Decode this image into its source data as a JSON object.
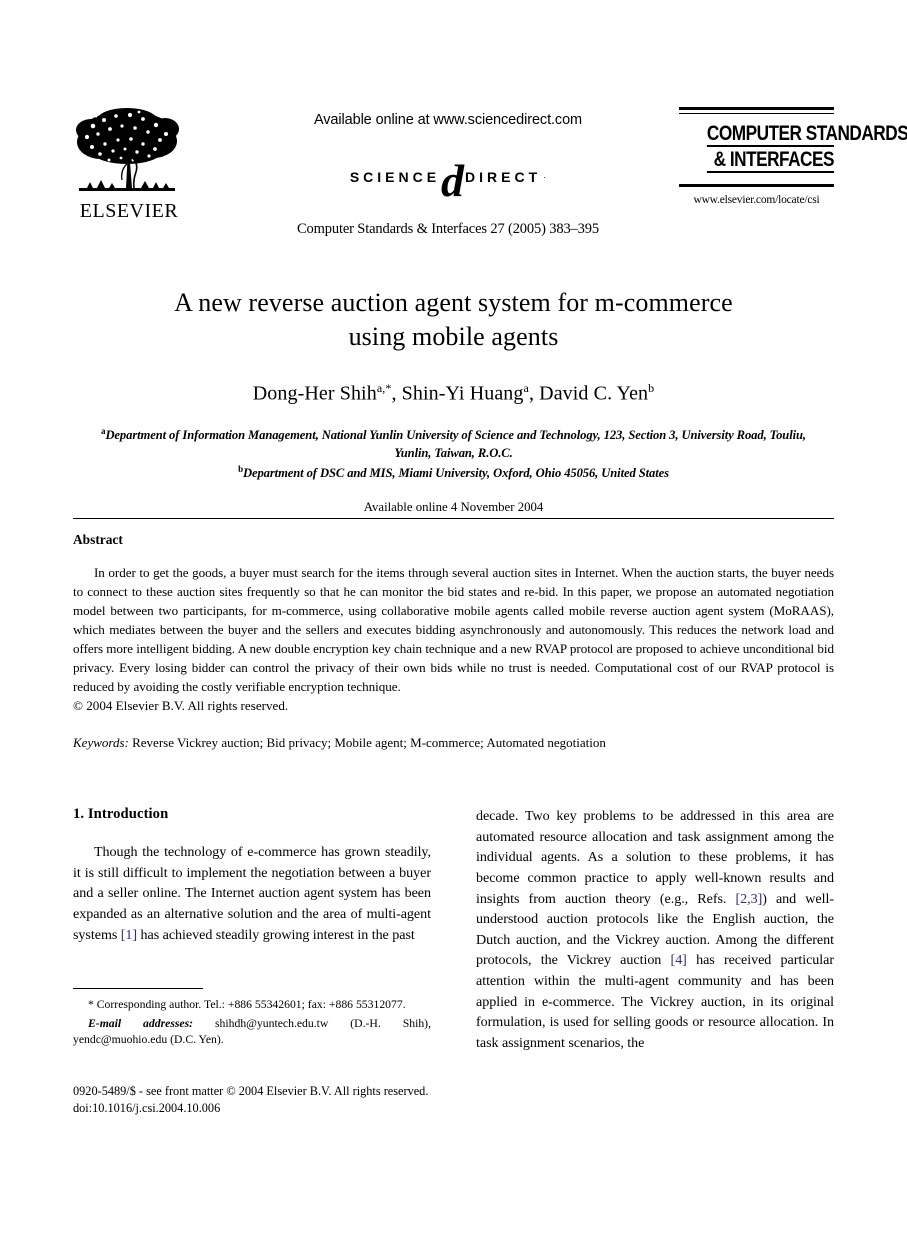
{
  "masthead": {
    "publisher_name": "ELSEVIER",
    "publisher_logo_icon": "elsevier-tree-logo",
    "available_online": "Available online at www.sciencedirect.com",
    "sciencedirect_word_left": "SCIENCE",
    "sciencedirect_glyph": "d",
    "sciencedirect_word_right": "DIRECT",
    "sciencedirect_registered": "·",
    "journal_citation": "Computer Standards & Interfaces 27 (2005) 383–395",
    "journal_logo_line1": "COMPUTER STANDARDS",
    "journal_logo_line2": "& INTERFACES",
    "journal_url": "www.elsevier.com/locate/csi"
  },
  "title": {
    "line1": "A new reverse auction agent system for m-commerce",
    "line2": "using mobile agents"
  },
  "authors": {
    "text": "Dong-Her Shih",
    "sup1": "a,*",
    "text2": ", Shin-Yi Huang",
    "sup2": "a",
    "text3": ", David C. Yen",
    "sup3": "b"
  },
  "affiliations": {
    "a_marker": "a",
    "a_text": "Department of Information Management, National Yunlin University of Science and Technology, 123, Section 3, University Road, Touliu, Yunlin, Taiwan, R.O.C.",
    "b_marker": "b",
    "b_text": "Department of DSC and MIS, Miami University, Oxford, Ohio 45056, United States",
    "available_date": "Available online 4 November 2004"
  },
  "abstract": {
    "heading": "Abstract",
    "body": "In order to get the goods, a buyer must search for the items through several auction sites in Internet. When the auction starts, the buyer needs to connect to these auction sites frequently so that he can monitor the bid states and re-bid. In this paper, we propose an automated negotiation model between two participants, for m-commerce, using collaborative mobile agents called mobile reverse auction agent system (MoRAAS), which mediates between the buyer and the sellers and executes bidding asynchronously and autonomously. This reduces the network load and offers more intelligent bidding. A new double encryption key chain technique and a new RVAP protocol are proposed to achieve unconditional bid privacy. Every losing bidder can control the privacy of their own bids while no trust is needed. Computational cost of our RVAP protocol is reduced by avoiding the costly verifiable encryption technique.",
    "copyright": "© 2004 Elsevier B.V. All rights reserved.",
    "keywords_label": "Keywords:",
    "keywords_value": "Reverse Vickrey auction; Bid privacy; Mobile agent; M-commerce; Automated negotiation"
  },
  "introduction": {
    "heading": "1. Introduction",
    "left_part1": "Though the technology of e-commerce has grown steadily, it is still difficult to implement the negotiation between a buyer and a seller online. The Internet auction agent system has been expanded as an alternative solution and the area of multi-agent systems ",
    "left_ref1": "[1]",
    "left_part2": " has achieved steadily growing interest in the past",
    "right_part1": "decade. Two key problems to be addressed in this area are automated resource allocation and task assignment among the individual agents. As a solution to these problems, it has become common practice to apply well-known results and insights from auction theory (e.g., Refs. ",
    "right_ref1": "[2,3]",
    "right_part2": ") and well-understood auction protocols like the English auction, the Dutch auction, and the Vickrey auction. Among the different protocols, the Vickrey auction ",
    "right_ref2": "[4]",
    "right_part3": " has received particular attention within the multi-agent community and has been applied in e-commerce. The Vickrey auction, in its original formulation, is used for selling goods or resource allocation. In task assignment scenarios, the"
  },
  "footnotes": {
    "corresponding": "* Corresponding author. Tel.: +886 55342601; fax: +886 55312077.",
    "email_label": "E-mail addresses:",
    "email_text": " shihdh@yuntech.edu.tw (D.-H. Shih), yendc@muohio.edu (D.C. Yen).",
    "issn_line": "0920-5489/$ - see front matter © 2004 Elsevier B.V. All rights reserved.",
    "doi_line": "doi:10.1016/j.csi.2004.10.006"
  },
  "colors": {
    "reference_link": "#2b2b8f",
    "text": "#111111",
    "page_background": "#ffffff"
  }
}
